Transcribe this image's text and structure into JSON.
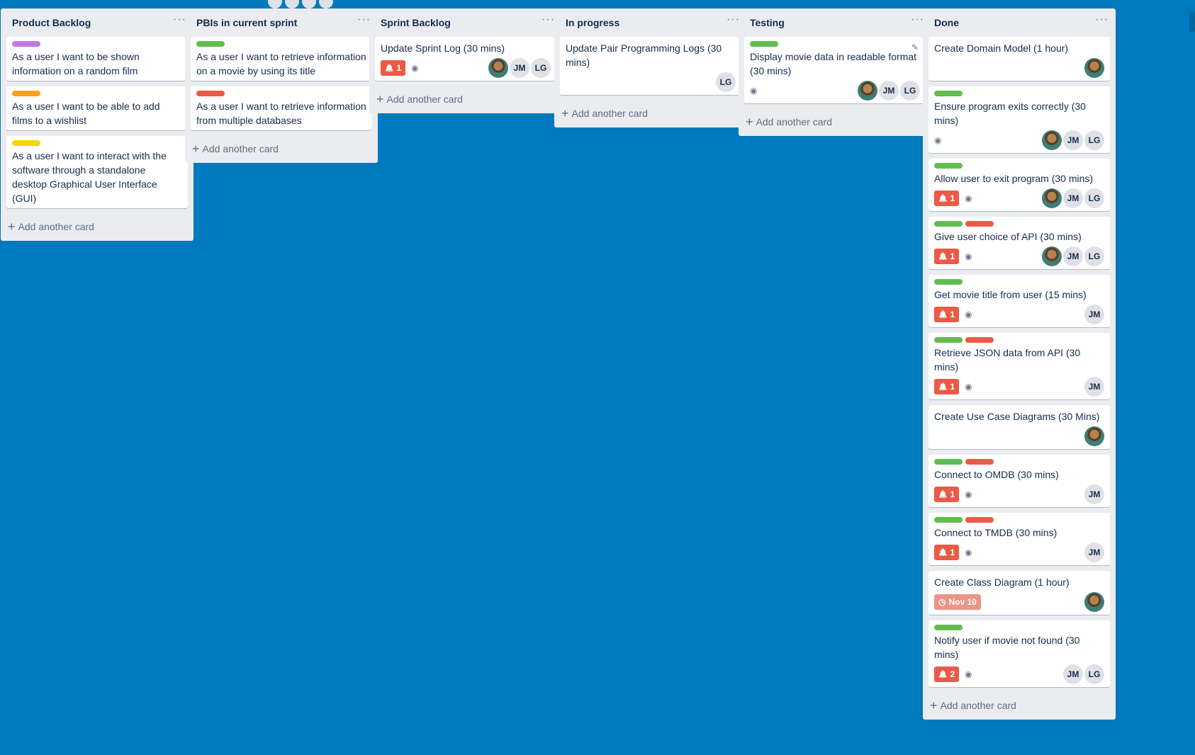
{
  "colors": {
    "background": "#0079bf",
    "green": "#61bd4f",
    "red": "#eb5a46",
    "orange": "#ff9f1a",
    "yellow": "#f2d600",
    "purple": "#c377e0",
    "alert": "#eb5a46",
    "date": "#ec9488"
  },
  "lists": [
    {
      "title": "Product Backlog",
      "add_label": "Add another card",
      "cards": [
        {
          "labels": [
            "purple"
          ],
          "title": "As a user I want to be shown information on a random film"
        },
        {
          "labels": [
            "orange"
          ],
          "title": "As a user I want to be able to add films to a wishlist"
        },
        {
          "labels": [
            "yellow"
          ],
          "title": "As a user I want to interact with the software through a standalone desktop Graphical User Interface (GUI)"
        }
      ]
    },
    {
      "title": "PBIs in current sprint",
      "add_label": "Add another card",
      "cards": [
        {
          "labels": [
            "green"
          ],
          "title": "As a user I want to retrieve information on a movie by using its title"
        },
        {
          "labels": [
            "red"
          ],
          "title": "As a user I want to retrieve information from multiple databases"
        }
      ]
    },
    {
      "title": "Sprint Backlog",
      "add_label": "Add another card",
      "cards": [
        {
          "labels": [],
          "title": "Update Sprint Log (30 mins)",
          "alert": "1",
          "watch": true,
          "members": [
            "photo",
            "JM",
            "LG"
          ]
        }
      ]
    },
    {
      "title": "In progress",
      "add_label": "Add another card",
      "cards": [
        {
          "labels": [],
          "title": "Update Pair Programming Logs (30 mins)",
          "members": [
            "LG"
          ]
        }
      ]
    },
    {
      "title": "Testing",
      "add_label": "Add another card",
      "cards": [
        {
          "labels": [
            "green"
          ],
          "title": "Display movie data in readable format (30 mins)",
          "watch": true,
          "edit": true,
          "members": [
            "photo",
            "JM",
            "LG"
          ]
        }
      ]
    },
    {
      "title": "Done",
      "add_label": "Add another card",
      "cards": [
        {
          "labels": [],
          "title": "Create Domain Model (1 hour)",
          "members": [
            "photo"
          ]
        },
        {
          "labels": [
            "green"
          ],
          "title": "Ensure program exits correctly (30 mins)",
          "watch": true,
          "members": [
            "photo",
            "JM",
            "LG"
          ]
        },
        {
          "labels": [
            "green"
          ],
          "title": "Allow user to exit program (30 mins)",
          "alert": "1",
          "watch": true,
          "members": [
            "photo",
            "JM",
            "LG"
          ]
        },
        {
          "labels": [
            "green",
            "red"
          ],
          "title": "Give user choice of API (30 mins)",
          "alert": "1",
          "watch": true,
          "members": [
            "photo",
            "JM",
            "LG"
          ]
        },
        {
          "labels": [
            "green"
          ],
          "title": "Get movie title from user (15 mins)",
          "alert": "1",
          "watch": true,
          "members": [
            "JM"
          ]
        },
        {
          "labels": [
            "green",
            "red"
          ],
          "title": "Retrieve JSON data from API (30 mins)",
          "alert": "1",
          "watch": true,
          "members": [
            "JM"
          ]
        },
        {
          "labels": [],
          "title": "Create Use Case Diagrams (30 Mins)",
          "members": [
            "photo"
          ]
        },
        {
          "labels": [
            "green",
            "red"
          ],
          "title": "Connect to OMDB (30 mins)",
          "alert": "1",
          "watch": true,
          "members": [
            "JM"
          ]
        },
        {
          "labels": [
            "green",
            "red"
          ],
          "title": "Connect to TMDB (30 mins)",
          "alert": "1",
          "watch": true,
          "members": [
            "JM"
          ]
        },
        {
          "labels": [],
          "title": "Create Class Diagram (1 hour)",
          "date": "Nov 10",
          "members": [
            "photo"
          ]
        },
        {
          "labels": [
            "green"
          ],
          "title": "Notify user if movie not found (30 mins)",
          "alert": "2",
          "watch": true,
          "members": [
            "JM",
            "LG"
          ]
        }
      ]
    }
  ]
}
